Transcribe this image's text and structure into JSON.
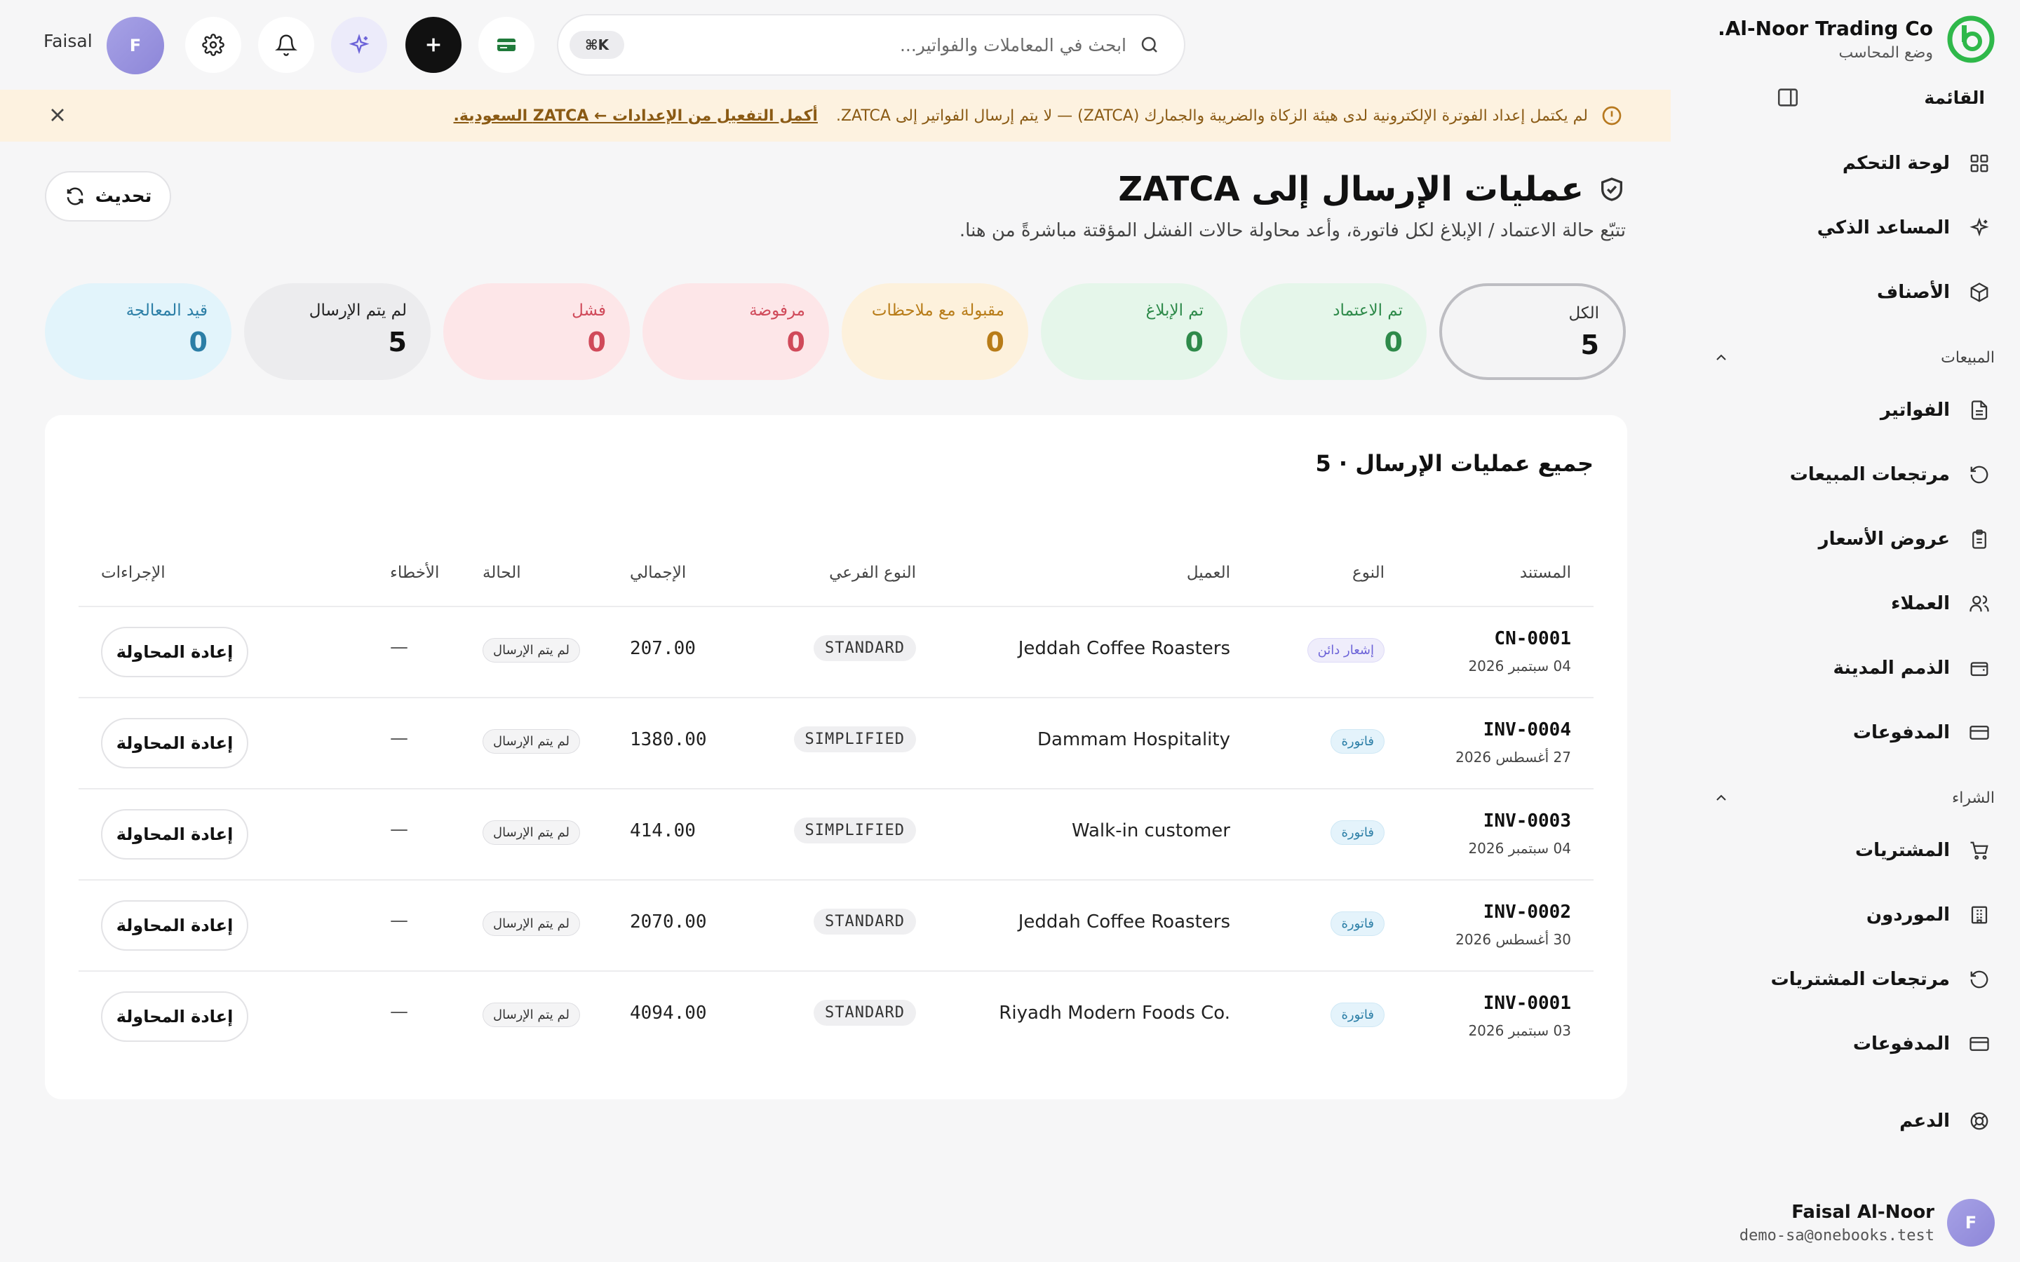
{
  "brand": {
    "name": "Al-Noor Trading Co.",
    "mode": "وضع المحاسب"
  },
  "sidebar": {
    "menu_label": "القائمة",
    "items": [
      {
        "label": "لوحة التحكم",
        "icon": "dashboard-icon"
      },
      {
        "label": "المساعد الذكي",
        "icon": "sparkles-icon"
      },
      {
        "label": "الأصناف",
        "icon": "box-icon"
      }
    ],
    "sales_section": "المبيعات",
    "sales_items": [
      {
        "label": "الفواتير",
        "icon": "file-text-icon"
      },
      {
        "label": "مرتجعات المبيعات",
        "icon": "rotate-ccw-icon"
      },
      {
        "label": "عروض الأسعار",
        "icon": "clipboard-icon"
      },
      {
        "label": "العملاء",
        "icon": "users-icon"
      },
      {
        "label": "الذمم المدينة",
        "icon": "wallet-icon"
      },
      {
        "label": "المدفوعات",
        "icon": "credit-card-icon"
      }
    ],
    "purchase_section": "الشراء",
    "purchase_items": [
      {
        "label": "المشتريات",
        "icon": "cart-icon"
      },
      {
        "label": "الموردون",
        "icon": "building-icon"
      },
      {
        "label": "مرتجعات المشتريات",
        "icon": "rotate-ccw-icon"
      },
      {
        "label": "المدفوعات",
        "icon": "credit-card-icon"
      }
    ],
    "support_label": "الدعم",
    "user": {
      "initial": "F",
      "name": "Faisal Al-Noor",
      "email": "demo-sa@onebooks.test"
    }
  },
  "topbar": {
    "search_placeholder": "ابحث في المعاملات والفواتير...",
    "shortcut": "⌘K",
    "avatar_initial": "F",
    "username": "Faisal"
  },
  "banner": {
    "text": "لم يكتمل إعداد الفوترة الإلكترونية لدى هيئة الزكاة والضريبة والجمارك (ZATCA) — لا يتم إرسال الفواتير إلى ZATCA.",
    "link": "أكمل التفعيل من الإعدادات ← ZATCA السعودية."
  },
  "page": {
    "title": "عمليات الإرسال إلى ZATCA",
    "subtitle": "تتبّع حالة الاعتماد / الإبلاغ لكل فاتورة، وأعد محاولة حالات الفشل المؤقتة مباشرةً من هنا.",
    "refresh": "تحديث"
  },
  "stats": [
    {
      "label": "الكل",
      "value": "5"
    },
    {
      "label": "تم الاعتماد",
      "value": "0"
    },
    {
      "label": "تم الإبلاغ",
      "value": "0"
    },
    {
      "label": "مقبولة مع ملاحظات",
      "value": "0"
    },
    {
      "label": "مرفوضة",
      "value": "0"
    },
    {
      "label": "فشل",
      "value": "0"
    },
    {
      "label": "لم يتم الإرسال",
      "value": "5"
    },
    {
      "label": "قيد المعالجة",
      "value": "0"
    }
  ],
  "table": {
    "title": "جميع عمليات الإرسال · 5",
    "headers": {
      "document": "المستند",
      "type": "النوع",
      "customer": "العميل",
      "subtype": "النوع الفرعي",
      "total": "الإجمالي",
      "status": "الحالة",
      "errors": "الأخطاء",
      "actions": "الإجراءات"
    },
    "rows": [
      {
        "doc": "CN-0001",
        "date": "04 سبتمبر 2026",
        "type": "إشعار دائن",
        "customer": "Jeddah Coffee Roasters",
        "subtype": "STANDARD",
        "total": "207.00",
        "status": "لم يتم الإرسال",
        "errors": "—",
        "action": "إعادة المحاولة"
      },
      {
        "doc": "INV-0004",
        "date": "27 أغسطس 2026",
        "type": "فاتورة",
        "customer": "Dammam Hospitality",
        "subtype": "SIMPLIFIED",
        "total": "1380.00",
        "status": "لم يتم الإرسال",
        "errors": "—",
        "action": "إعادة المحاولة"
      },
      {
        "doc": "INV-0003",
        "date": "04 سبتمبر 2026",
        "type": "فاتورة",
        "customer": "Walk-in customer",
        "subtype": "SIMPLIFIED",
        "total": "414.00",
        "status": "لم يتم الإرسال",
        "errors": "—",
        "action": "إعادة المحاولة"
      },
      {
        "doc": "INV-0002",
        "date": "30 أغسطس 2026",
        "type": "فاتورة",
        "customer": "Jeddah Coffee Roasters",
        "subtype": "STANDARD",
        "total": "2070.00",
        "status": "لم يتم الإرسال",
        "errors": "—",
        "action": "إعادة المحاولة"
      },
      {
        "doc": "INV-0001",
        "date": "03 سبتمبر 2026",
        "type": "فاتورة",
        "customer": "Riyadh Modern Foods Co.",
        "subtype": "STANDARD",
        "total": "4094.00",
        "status": "لم يتم الإرسال",
        "errors": "—",
        "action": "إعادة المحاولة"
      }
    ]
  },
  "colors": {
    "brand_green": "#2fb84a",
    "warning_bg": "#fdf2e0",
    "warning_text": "#8a5a14",
    "ai_purple": "#6c63d8"
  }
}
